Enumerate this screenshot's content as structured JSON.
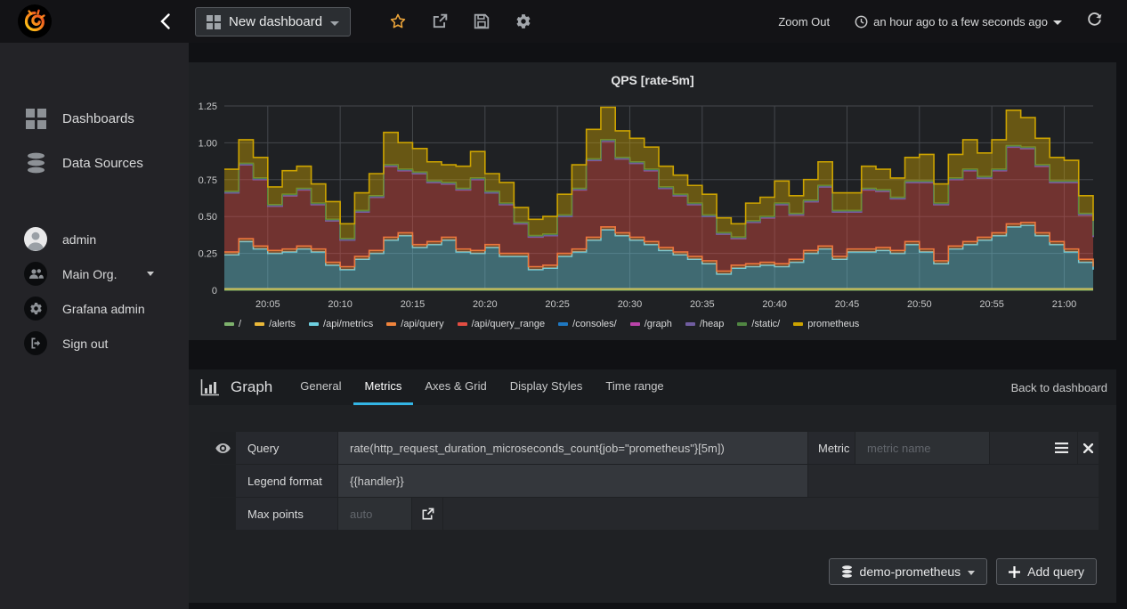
{
  "navbar": {
    "dashboard_button_label": "New dashboard",
    "zoom_out_label": "Zoom Out",
    "time_range_label": "an hour ago to a few seconds ago",
    "icons": [
      "back",
      "star",
      "share",
      "save",
      "settings",
      "clock",
      "refresh"
    ]
  },
  "sidebar": {
    "items": [
      {
        "label": "Dashboards",
        "icon": "grid-icon"
      },
      {
        "label": "Data Sources",
        "icon": "database-icon"
      }
    ],
    "user_items": [
      {
        "label": "admin",
        "icon": "avatar-icon"
      },
      {
        "label": "Main Org.",
        "icon": "users-icon",
        "has_caret": true
      },
      {
        "label": "Grafana admin",
        "icon": "gear-icon"
      },
      {
        "label": "Sign out",
        "icon": "sign-out-icon"
      }
    ]
  },
  "chart_panel": {
    "title": "QPS [rate-5m]"
  },
  "chart_data": {
    "type": "area",
    "stacked": true,
    "step_interpolation": true,
    "title": "QPS [rate-5m]",
    "ylim": [
      0,
      1.25
    ],
    "duration_minutes": 60,
    "x_range": [
      "20:02",
      "21:02"
    ],
    "grid": true,
    "legend_position": "bottom",
    "fill_opacity": 0.42,
    "y_ticks": [
      {
        "value": 0,
        "label": "0"
      },
      {
        "value": 0.25,
        "label": "0.25"
      },
      {
        "value": 0.5,
        "label": "0.50"
      },
      {
        "value": 0.75,
        "label": "0.75"
      },
      {
        "value": 1.0,
        "label": "1.00"
      },
      {
        "value": 1.25,
        "label": "1.25"
      }
    ],
    "x_ticks": [
      {
        "minute": 3,
        "label": "20:05"
      },
      {
        "minute": 8,
        "label": "20:10"
      },
      {
        "minute": 13,
        "label": "20:15"
      },
      {
        "minute": 18,
        "label": "20:20"
      },
      {
        "minute": 23,
        "label": "20:25"
      },
      {
        "minute": 28,
        "label": "20:30"
      },
      {
        "minute": 33,
        "label": "20:35"
      },
      {
        "minute": 38,
        "label": "20:40"
      },
      {
        "minute": 43,
        "label": "20:45"
      },
      {
        "minute": 48,
        "label": "20:50"
      },
      {
        "minute": 53,
        "label": "20:55"
      },
      {
        "minute": 58,
        "label": "21:00"
      }
    ],
    "series": [
      {
        "name": "/",
        "color": "#7EB26D",
        "const": 0.002
      },
      {
        "name": "/alerts",
        "color": "#EAB839",
        "const": 0.008
      },
      {
        "name": "/api/metrics",
        "color": "#6ED0E0",
        "values": [
          0.23,
          0.32,
          0.27,
          0.24,
          0.25,
          0.27,
          0.25,
          0.16,
          0.13,
          0.2,
          0.24,
          0.33,
          0.36,
          0.28,
          0.3,
          0.33,
          0.25,
          0.24,
          0.28,
          0.22,
          0.22,
          0.13,
          0.14,
          0.22,
          0.25,
          0.33,
          0.4,
          0.36,
          0.33,
          0.3,
          0.26,
          0.23,
          0.2,
          0.17,
          0.1,
          0.14,
          0.15,
          0.16,
          0.15,
          0.18,
          0.24,
          0.27,
          0.2,
          0.25,
          0.25,
          0.26,
          0.24,
          0.3,
          0.25,
          0.17,
          0.27,
          0.3,
          0.33,
          0.36,
          0.42,
          0.43,
          0.36,
          0.3,
          0.25,
          0.18,
          0.13
        ]
      },
      {
        "name": "/api/query",
        "color": "#EF843C",
        "const": 0.02
      },
      {
        "name": "/api/query_range",
        "color": "#E24D42",
        "values": [
          0.4,
          0.5,
          0.45,
          0.3,
          0.36,
          0.38,
          0.3,
          0.28,
          0.18,
          0.3,
          0.36,
          0.48,
          0.42,
          0.48,
          0.4,
          0.36,
          0.4,
          0.48,
          0.35,
          0.33,
          0.2,
          0.2,
          0.2,
          0.25,
          0.4,
          0.52,
          0.58,
          0.5,
          0.5,
          0.48,
          0.4,
          0.38,
          0.35,
          0.3,
          0.25,
          0.18,
          0.28,
          0.3,
          0.4,
          0.3,
          0.33,
          0.4,
          0.3,
          0.25,
          0.4,
          0.38,
          0.35,
          0.4,
          0.45,
          0.38,
          0.45,
          0.48,
          0.4,
          0.42,
          0.52,
          0.5,
          0.45,
          0.4,
          0.45,
          0.3,
          0.2
        ]
      },
      {
        "name": "/consoles/",
        "color": "#1F78C1",
        "const": 0.001
      },
      {
        "name": "/graph",
        "color": "#BA43A9",
        "const": 0.001
      },
      {
        "name": "/heap",
        "color": "#705DA0",
        "const": 0.001
      },
      {
        "name": "/static/",
        "color": "#508642",
        "const": 0.008
      },
      {
        "name": "prometheus",
        "color": "#CCA300",
        "values": [
          0.15,
          0.16,
          0.14,
          0.12,
          0.16,
          0.15,
          0.13,
          0.12,
          0.1,
          0.12,
          0.15,
          0.22,
          0.18,
          0.16,
          0.13,
          0.12,
          0.15,
          0.18,
          0.12,
          0.14,
          0.1,
          0.11,
          0.12,
          0.14,
          0.16,
          0.2,
          0.22,
          0.18,
          0.16,
          0.15,
          0.14,
          0.13,
          0.12,
          0.14,
          0.1,
          0.09,
          0.12,
          0.13,
          0.15,
          0.12,
          0.14,
          0.16,
          0.12,
          0.12,
          0.15,
          0.14,
          0.13,
          0.16,
          0.18,
          0.13,
          0.16,
          0.2,
          0.16,
          0.2,
          0.24,
          0.2,
          0.18,
          0.16,
          0.14,
          0.12,
          0.1
        ]
      }
    ]
  },
  "editor": {
    "panel_type_label": "Graph",
    "tabs": [
      "General",
      "Metrics",
      "Axes & Grid",
      "Display Styles",
      "Time range"
    ],
    "active_tab": "Metrics",
    "back_link": "Back to dashboard",
    "query_row": {
      "label": "Query",
      "value": "rate(http_request_duration_microseconds_count{job=\"prometheus\"}[5m])",
      "metric_label": "Metric",
      "metric_placeholder": "metric name"
    },
    "legend_row": {
      "label": "Legend format",
      "value": "{{handler}}"
    },
    "max_points_row": {
      "label": "Max points",
      "placeholder": "auto"
    },
    "datasource_button_label": "demo-prometheus",
    "add_query_button_label": "Add query"
  },
  "colors": {
    "accent_orange": "#eb7b18",
    "star": "#eda53a",
    "tab_underline": "#33b5e5",
    "panel_bg": "#1f2124",
    "sidebar_bg": "#232327",
    "navbar_bg": "#131316"
  }
}
